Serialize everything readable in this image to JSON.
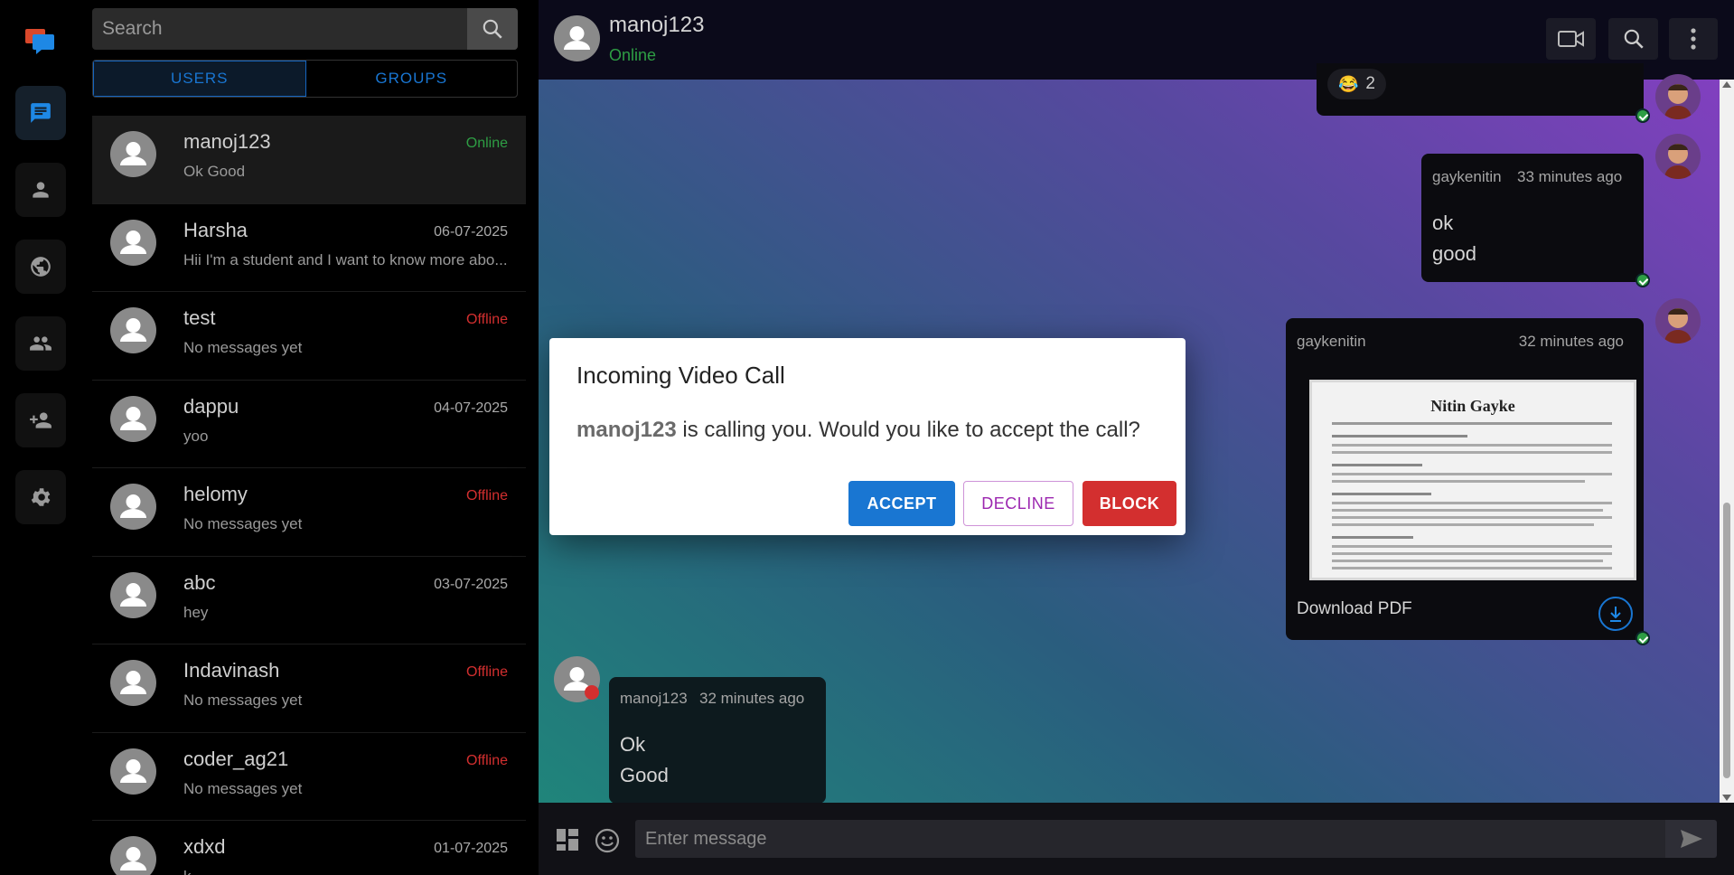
{
  "search": {
    "placeholder": "Search"
  },
  "tabs": [
    {
      "label": "USERS"
    },
    {
      "label": "GROUPS"
    }
  ],
  "conversations": [
    {
      "name": "manoj123",
      "preview": "Ok Good",
      "meta": "Online",
      "status": "online"
    },
    {
      "name": "Harsha",
      "preview": "Hii I'm a student and I want to know more abo...",
      "meta": "06-07-2025",
      "status": "date"
    },
    {
      "name": "test",
      "preview": "No messages yet",
      "meta": "Offline",
      "status": "offline"
    },
    {
      "name": "dappu",
      "preview": "yoo",
      "meta": "04-07-2025",
      "status": "date"
    },
    {
      "name": "helomy",
      "preview": "No messages yet",
      "meta": "Offline",
      "status": "offline"
    },
    {
      "name": "abc",
      "preview": "hey",
      "meta": "03-07-2025",
      "status": "date"
    },
    {
      "name": "Indavinash",
      "preview": "No messages yet",
      "meta": "Offline",
      "status": "offline"
    },
    {
      "name": "coder_ag21",
      "preview": "No messages yet",
      "meta": "Offline",
      "status": "offline"
    },
    {
      "name": "xdxd",
      "preview": "k",
      "meta": "01-07-2025",
      "status": "date"
    }
  ],
  "chat_header": {
    "name": "manoj123",
    "status": "Online"
  },
  "messages": {
    "reaction": {
      "emoji": "😂",
      "count": "2"
    },
    "msg1": {
      "sender": "gaykenitin",
      "time": "33 minutes ago",
      "lines": [
        "ok",
        "good"
      ]
    },
    "msg2": {
      "sender": "gaykenitin",
      "time": "32 minutes ago",
      "pdf_title": "Nitin Gayke",
      "download_label": "Download PDF"
    },
    "msg3": {
      "sender": "manoj123",
      "time": "32 minutes ago",
      "lines": [
        "Ok",
        "Good"
      ]
    }
  },
  "composer": {
    "placeholder": "Enter message"
  },
  "modal": {
    "title": "Incoming Video Call",
    "caller": "manoj123",
    "text": " is calling you. Would you like to accept the call?",
    "accept": "ACCEPT",
    "decline": "DECLINE",
    "block": "BLOCK"
  },
  "colors": {
    "accent": "#1976d2",
    "online": "#2e9e44",
    "offline": "#d32f2f",
    "decline": "#9c27b0"
  }
}
